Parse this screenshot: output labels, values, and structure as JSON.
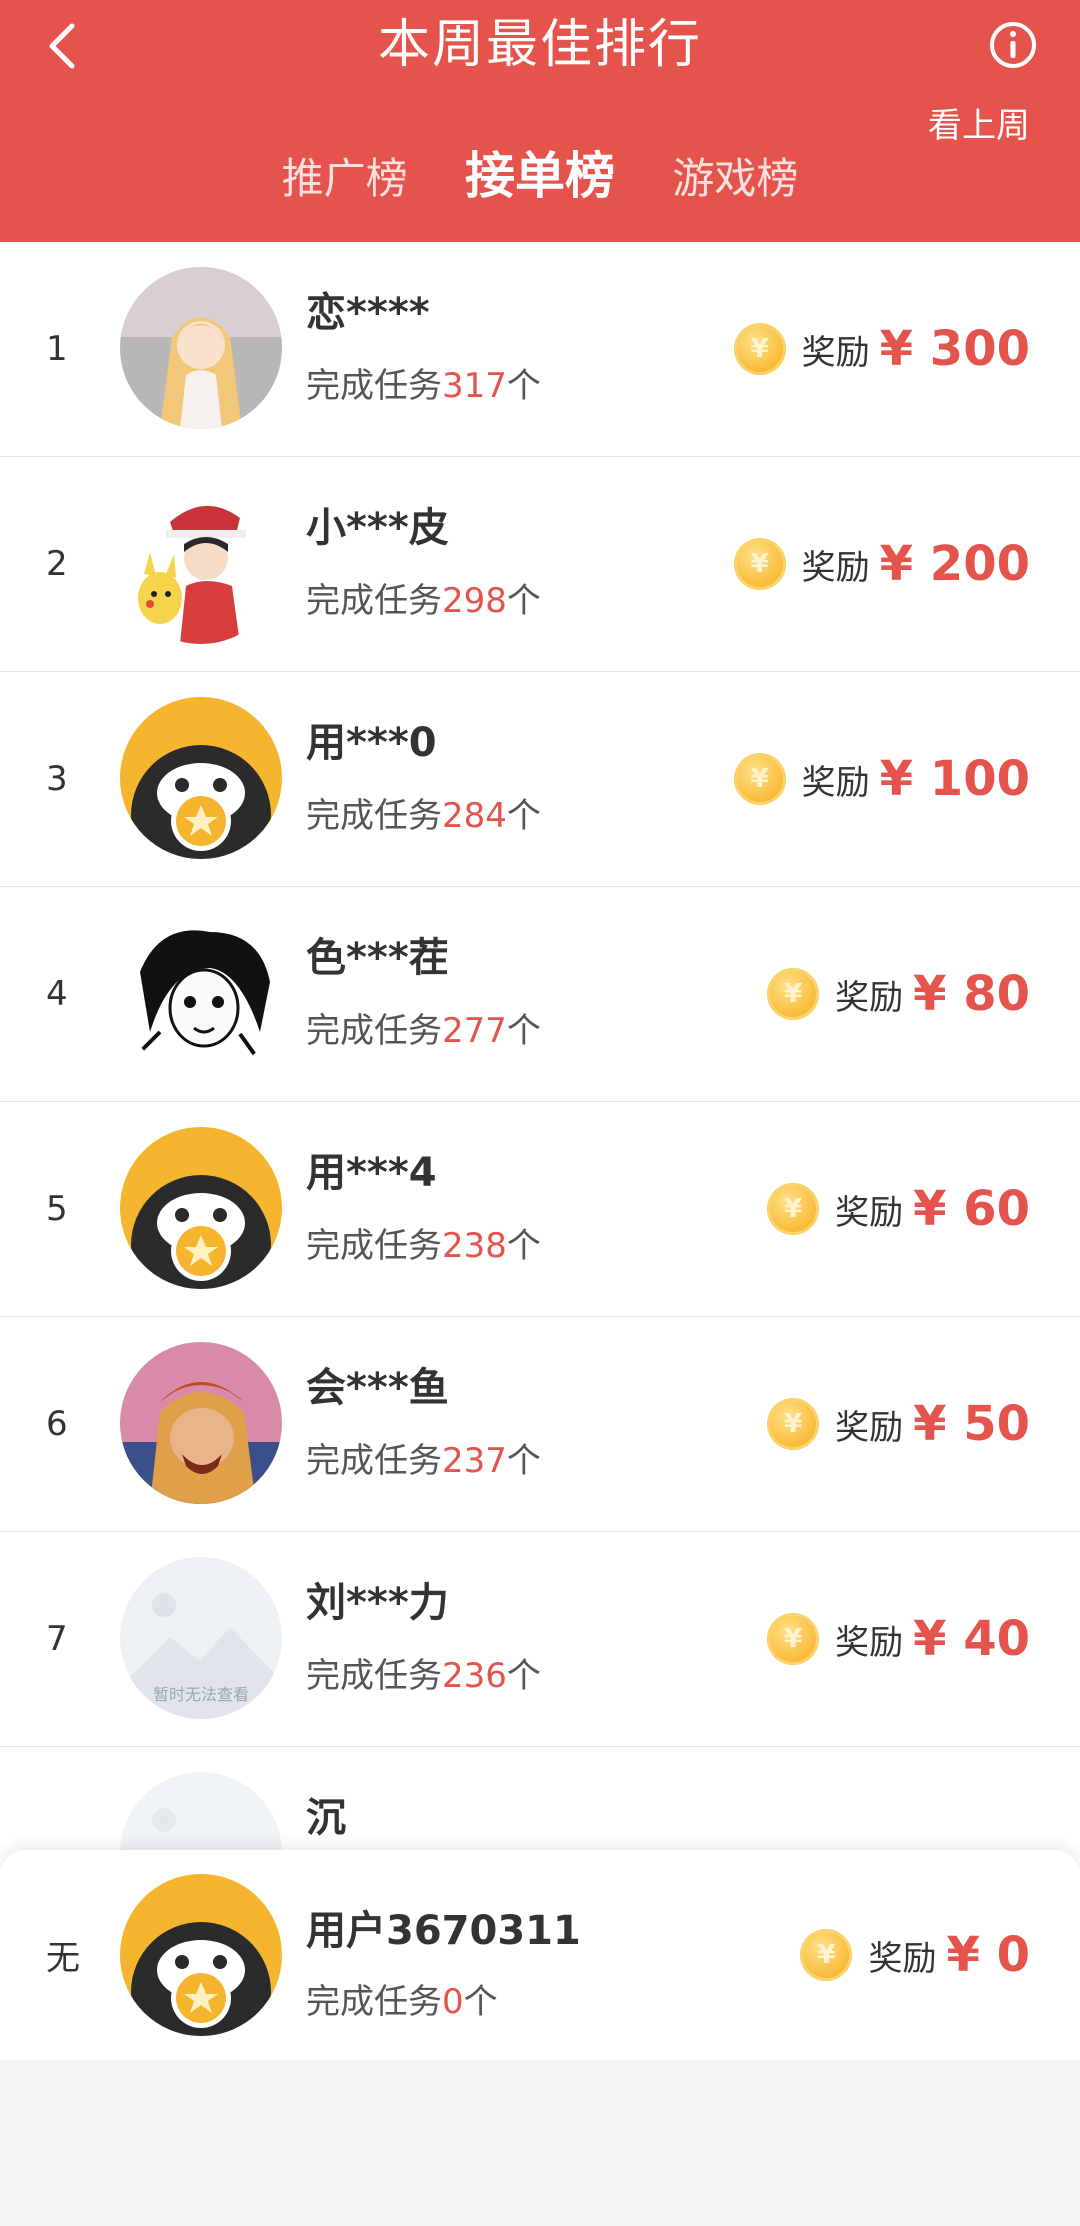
{
  "header": {
    "title": "本周最佳排行",
    "last_week": "看上周",
    "tabs": [
      "推广榜",
      "接单榜",
      "游戏榜"
    ],
    "active_tab": 1,
    "accent": "#e4544c"
  },
  "task_prefix": "完成任务",
  "task_suffix": "个",
  "reward_label": "奖励",
  "currency": "¥",
  "coin_glyph": "¥",
  "rows": [
    {
      "rank": "1",
      "name": "恋****",
      "tasks": "317",
      "amount": "300",
      "avatar": "anime-girl-avatar"
    },
    {
      "rank": "2",
      "name": "小***皮",
      "tasks": "298",
      "amount": "200",
      "avatar": "trainer-avatar"
    },
    {
      "rank": "3",
      "name": "用***0",
      "tasks": "284",
      "amount": "100",
      "avatar": "penguin-avatar"
    },
    {
      "rank": "4",
      "name": "色***茬",
      "tasks": "277",
      "amount": "80",
      "avatar": "manga-avatar"
    },
    {
      "rank": "5",
      "name": "用***4",
      "tasks": "238",
      "amount": "60",
      "avatar": "penguin-avatar"
    },
    {
      "rank": "6",
      "name": "会***鱼",
      "tasks": "237",
      "amount": "50",
      "avatar": "game-hero-avatar"
    },
    {
      "rank": "7",
      "name": "刘***力",
      "tasks": "236",
      "amount": "40",
      "avatar": "placeholder-avatar",
      "avatar_text": "暂时无法查看"
    },
    {
      "rank": "",
      "name": "沉",
      "tasks": "",
      "amount": "",
      "avatar": "placeholder-avatar"
    }
  ],
  "me": {
    "rank": "无",
    "name": "用户3670311",
    "tasks": "0",
    "amount": "0",
    "avatar": "penguin-avatar"
  }
}
